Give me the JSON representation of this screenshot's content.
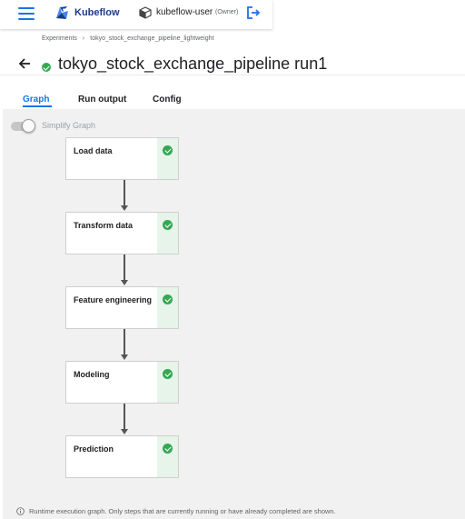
{
  "header": {
    "brand": "Kubeflow",
    "namespace_user": "kubeflow-user",
    "namespace_role": "(Owner)"
  },
  "breadcrumb": {
    "items": [
      "Experiments",
      "tokyo_stock_exchange_pipeline_lightweight"
    ],
    "separator": "›"
  },
  "run": {
    "title": "tokyo_stock_exchange_pipeline run1",
    "status": "succeeded"
  },
  "tabs": [
    {
      "label": "Graph",
      "active": true
    },
    {
      "label": "Run output",
      "active": false
    },
    {
      "label": "Config",
      "active": false
    }
  ],
  "graph": {
    "simplify_label": "Simplify Graph",
    "simplify_enabled": false,
    "nodes": [
      {
        "label": "Load data",
        "status": "succeeded"
      },
      {
        "label": "Transform data",
        "status": "succeeded"
      },
      {
        "label": "Feature engineering",
        "status": "succeeded"
      },
      {
        "label": "Modeling",
        "status": "succeeded"
      },
      {
        "label": "Prediction",
        "status": "succeeded"
      }
    ],
    "footer_note": "Runtime execution graph. Only steps that are currently running or have already completed are shown."
  },
  "colors": {
    "accent": "#1a73e8",
    "success": "#34a853",
    "success_bg": "#e6f4ea"
  },
  "icons": {
    "menu": "hamburger-menu-icon",
    "logo": "kubeflow-logo-icon",
    "namespace": "cube-icon",
    "logout": "logout-icon",
    "back": "back-arrow-icon",
    "status": "check-circle-icon",
    "info": "info-icon"
  }
}
